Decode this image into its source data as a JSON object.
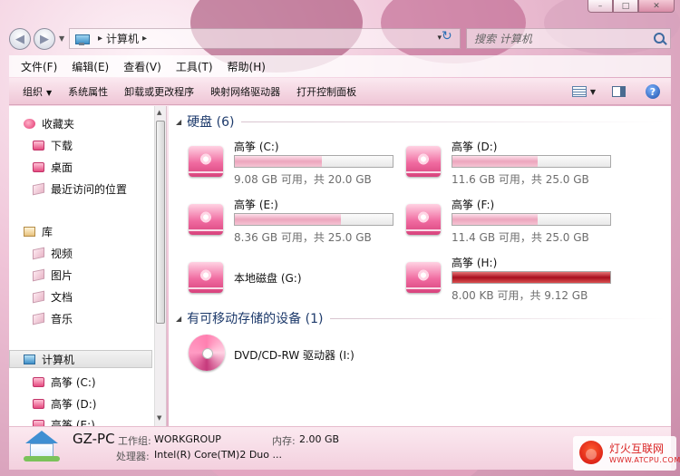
{
  "window": {
    "controls": {
      "minimize": "–",
      "maximize": "□",
      "close": "✕"
    }
  },
  "address": {
    "root_separator": "▸",
    "current": "计算机",
    "end_separator": "▸",
    "dropdown": "▾",
    "refresh": "↻"
  },
  "search": {
    "placeholder": "搜索 计算机"
  },
  "menu": [
    "文件(F)",
    "编辑(E)",
    "查看(V)",
    "工具(T)",
    "帮助(H)"
  ],
  "toolbar": {
    "organize": "组织",
    "organize_arrow": "▼",
    "buttons": [
      "系统属性",
      "卸载或更改程序",
      "映射网络驱动器",
      "打开控制面板"
    ],
    "view_arrow": "▼",
    "help": "?"
  },
  "sidebar": {
    "favorites": {
      "label": "收藏夹",
      "items": [
        "下载",
        "桌面",
        "最近访问的位置"
      ]
    },
    "libraries": {
      "label": "库",
      "items": [
        "视频",
        "图片",
        "文档",
        "音乐"
      ]
    },
    "computer": {
      "label": "计算机",
      "items": [
        "高筝 (C:)",
        "高筝 (D:)",
        "高筝 (E:)"
      ]
    }
  },
  "groups": {
    "hard_disks": "硬盘 (6)",
    "removable": "有可移动存储的设备 (1)"
  },
  "drives": [
    {
      "name": "高筝 (C:)",
      "info": "9.08 GB 可用，共 20.0 GB",
      "used_fraction": 0.55
    },
    {
      "name": "高筝 (D:)",
      "info": "11.6 GB 可用，共 25.0 GB",
      "used_fraction": 0.54
    },
    {
      "name": "高筝 (E:)",
      "info": "8.36 GB 可用，共 25.0 GB",
      "used_fraction": 0.67
    },
    {
      "name": "高筝 (F:)",
      "info": "11.4 GB 可用，共 25.0 GB",
      "used_fraction": 0.54
    },
    {
      "name": "本地磁盘 (G:)",
      "info": "",
      "used_fraction": null
    },
    {
      "name": "高筝 (H:)",
      "info": "8.00 KB 可用，共 9.12 GB",
      "used_fraction": 1.0
    }
  ],
  "removable_drives": [
    {
      "name": "DVD/CD-RW 驱动器 (I:)"
    }
  ],
  "details": {
    "computer_name": "GZ-PC",
    "workgroup_label": "工作组:",
    "workgroup_value": "WORKGROUP",
    "memory_label": "内存:",
    "memory_value": "2.00 GB",
    "processor_label": "处理器:",
    "processor_value": "Intel(R) Core(TM)2 Duo ..."
  },
  "watermark": {
    "title": "灯火互联网",
    "url": "WWW.ATCPU.COM"
  },
  "colors": {
    "accent": "#1d3a6b",
    "drive_full": "#a80f1e",
    "drive_icon": "#f06ba0"
  }
}
